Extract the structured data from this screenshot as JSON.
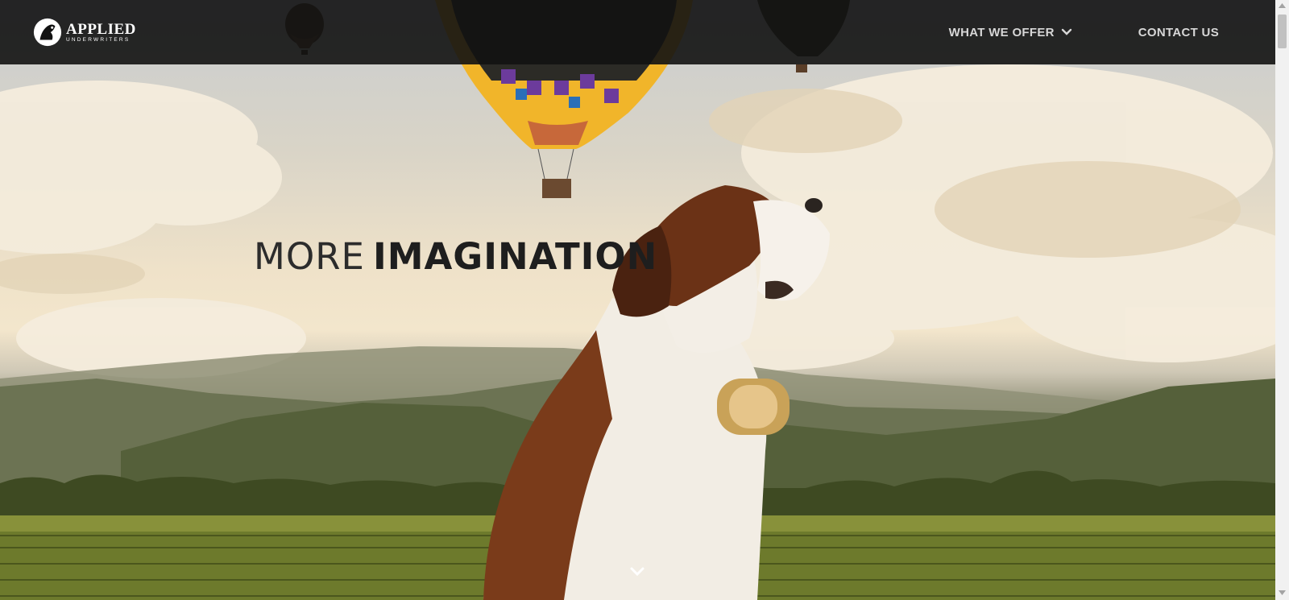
{
  "brand": {
    "title": "APPLIED",
    "subtitle": "UNDERWRITERS",
    "logo_icon": "dog-seal-icon"
  },
  "nav": {
    "items": [
      {
        "label": "WHAT WE OFFER",
        "icon": "chevron-down-icon"
      },
      {
        "label": "CONTACT US"
      }
    ]
  },
  "hero": {
    "headline_light": "MORE",
    "headline_bold": "IMAGINATION",
    "scroll_icon": "chevron-down-icon"
  },
  "colors": {
    "topbar": "#121212",
    "nav_text": "#d7d7d7",
    "headline": "#1e1e1e"
  }
}
